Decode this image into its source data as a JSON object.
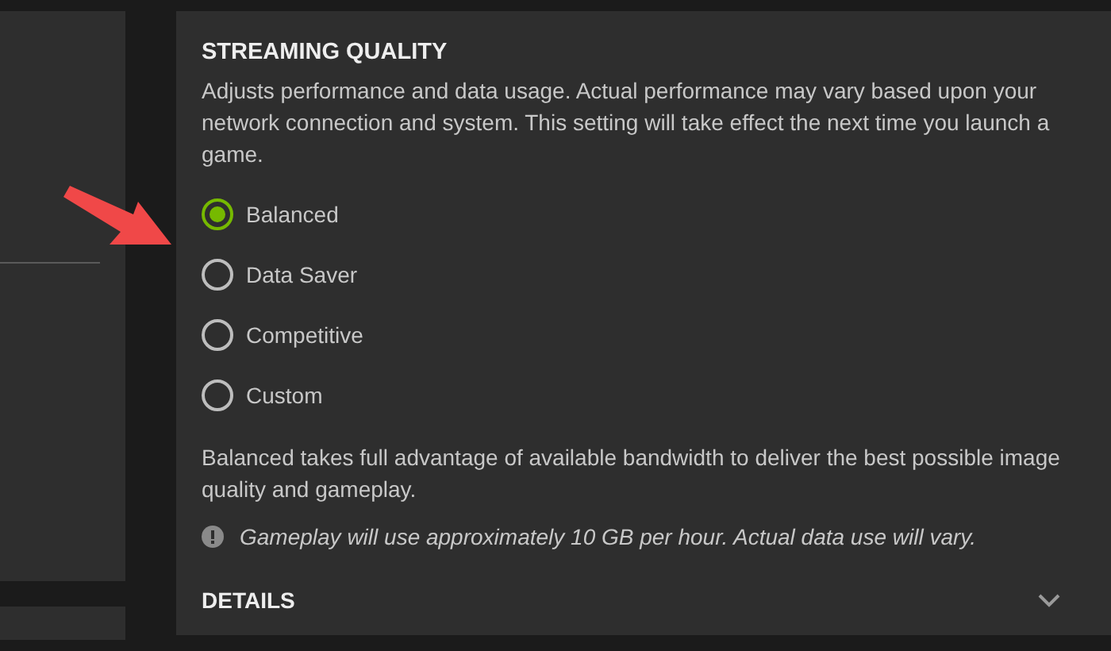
{
  "section": {
    "title": "STREAMING QUALITY",
    "description": "Adjusts performance and data usage. Actual performance may vary based upon your network connection and system. This setting will take effect the next time you launch a game."
  },
  "options": [
    {
      "label": "Balanced",
      "selected": true
    },
    {
      "label": "Data Saver",
      "selected": false
    },
    {
      "label": "Competitive",
      "selected": false
    },
    {
      "label": "Custom",
      "selected": false
    }
  ],
  "option_description": "Balanced takes full advantage of available bandwidth to deliver the best possible image quality and gameplay.",
  "notice": "Gameplay will use approximately 10 GB per hour. Actual data use will vary.",
  "details": {
    "label": "DETAILS",
    "expanded": false
  }
}
